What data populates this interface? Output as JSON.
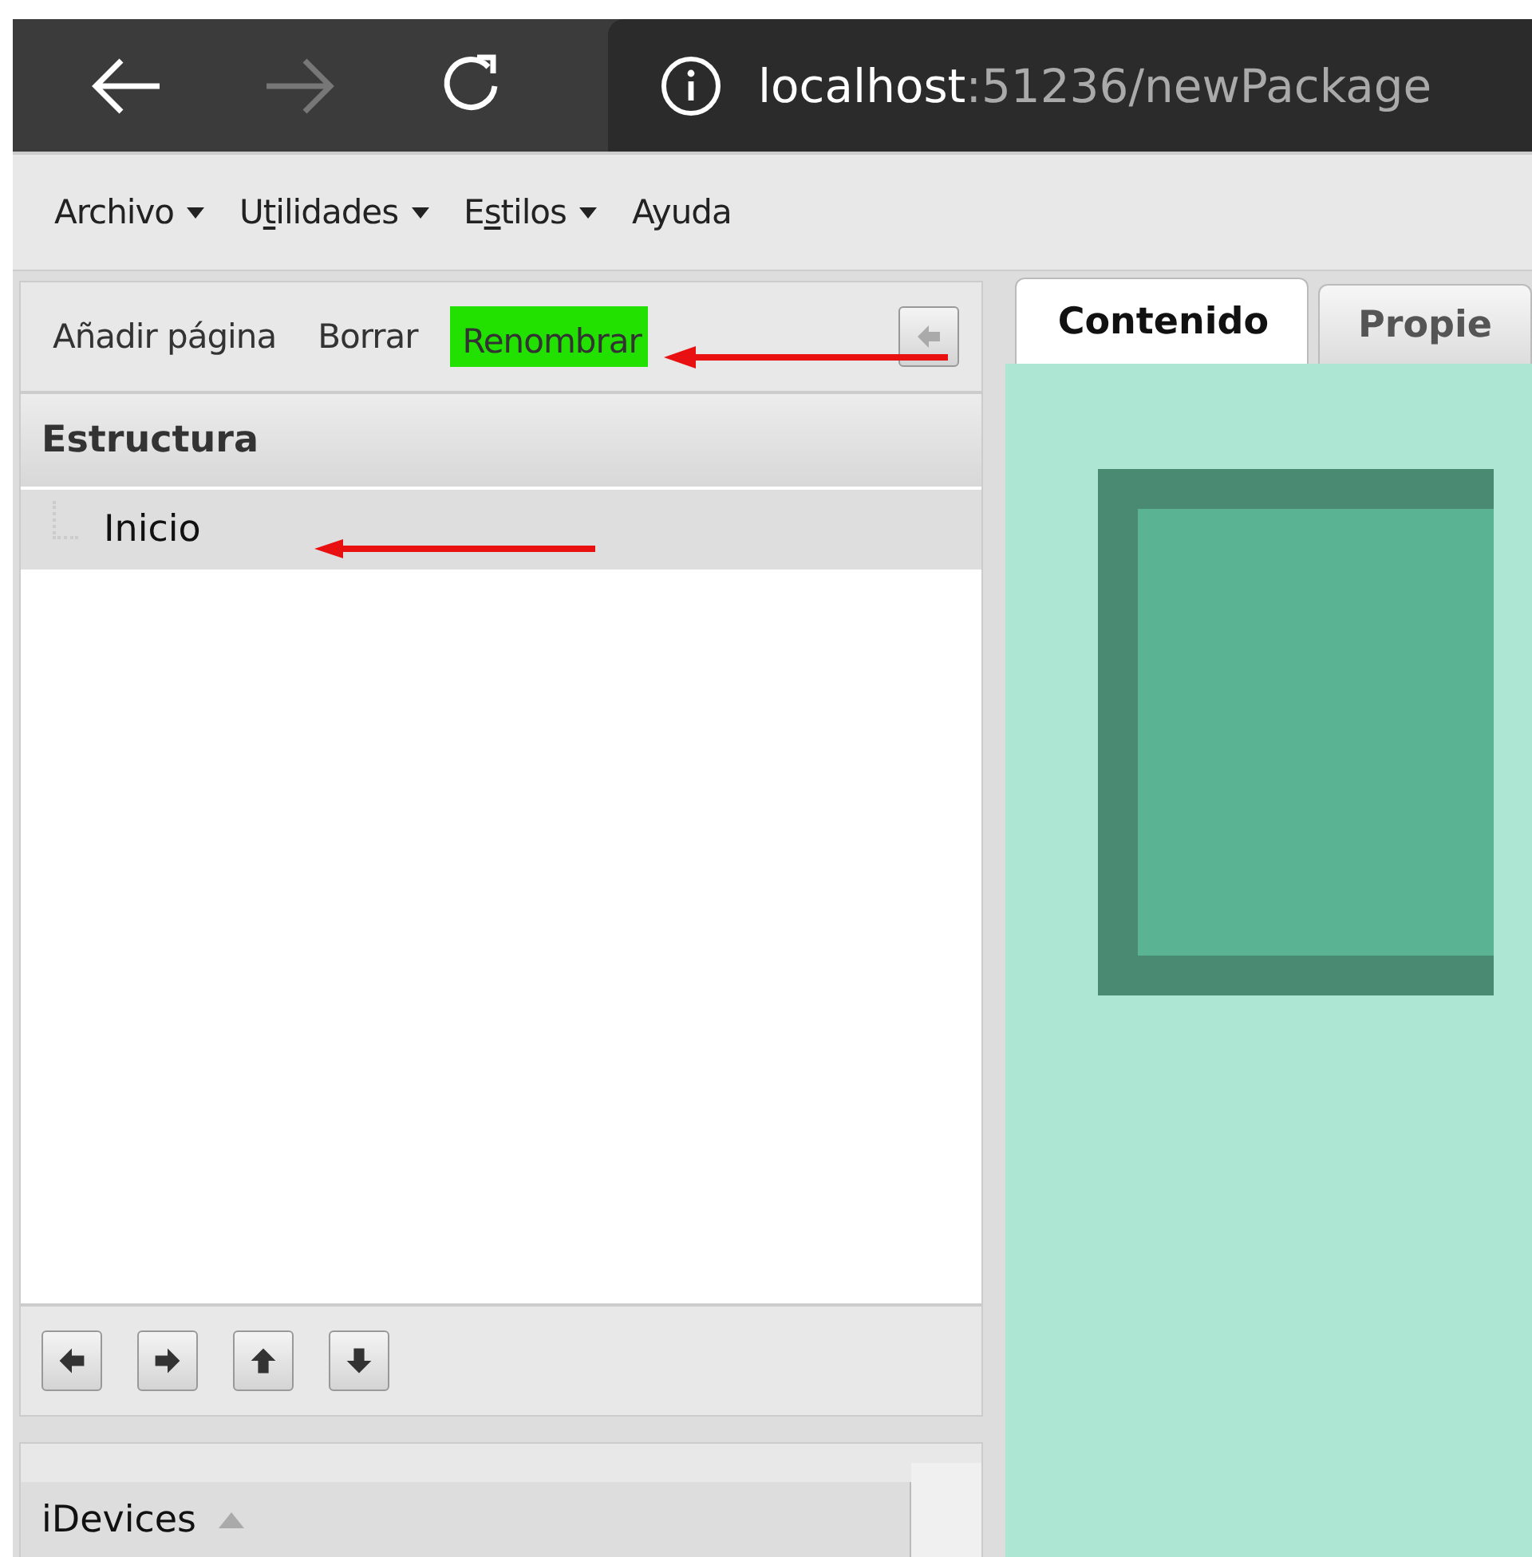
{
  "browser": {
    "url_host": "localhost",
    "url_rest": ":51236/newPackage",
    "back_disabled": false,
    "forward_disabled": true
  },
  "menu": [
    {
      "before": "Archivo",
      "has_dropdown": true
    },
    {
      "before": "U",
      "key": "t",
      "after": "ilidades",
      "has_dropdown": true
    },
    {
      "before": "E",
      "key": "s",
      "after": "tilos",
      "has_dropdown": true
    },
    {
      "before": "Ayuda",
      "has_dropdown": false
    }
  ],
  "toolbar": [
    {
      "label": "Añadir página",
      "highlighted": false,
      "pointed_at": false
    },
    {
      "label": "Borrar",
      "highlighted": false,
      "pointed_at": false
    },
    {
      "label": "Renombrar",
      "highlighted": true,
      "pointed_at": true
    }
  ],
  "structure": {
    "title": "Estructura",
    "items": [
      {
        "label": "Inicio",
        "selected": true,
        "pointed_at": true
      }
    ]
  },
  "move_buttons": [
    {
      "kind": "left"
    },
    {
      "kind": "right"
    },
    {
      "kind": "up"
    },
    {
      "kind": "down"
    }
  ],
  "idevices": {
    "title": "iDevices",
    "expanded": true
  },
  "tabs": [
    {
      "label": "Contenido",
      "selected": true
    },
    {
      "label": "Propie",
      "selected": false
    }
  ]
}
